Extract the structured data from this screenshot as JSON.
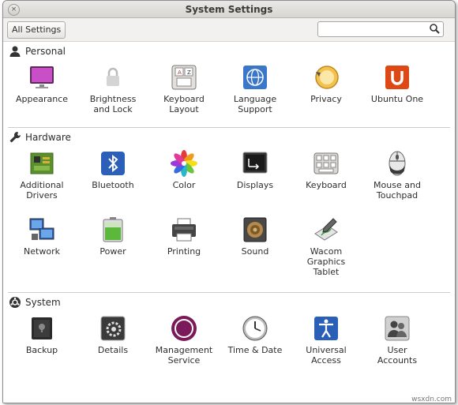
{
  "window": {
    "title": "System Settings",
    "close_glyph": "×"
  },
  "toolbar": {
    "all_settings_label": "All Settings",
    "search_value": "",
    "search_placeholder": ""
  },
  "sections": [
    {
      "title": "Personal",
      "items": [
        "Appearance",
        "Brightness\nand Lock",
        "Keyboard\nLayout",
        "Language\nSupport",
        "Privacy",
        "Ubuntu One"
      ]
    },
    {
      "title": "Hardware",
      "items": [
        "Additional\nDrivers",
        "Bluetooth",
        "Color",
        "Displays",
        "Keyboard",
        "Mouse and\nTouchpad",
        "Network",
        "Power",
        "Printing",
        "Sound",
        "Wacom\nGraphics\nTablet"
      ]
    },
    {
      "title": "System",
      "items": [
        "Backup",
        "Details",
        "Management\nService",
        "Time & Date",
        "Universal\nAccess",
        "User\nAccounts"
      ]
    }
  ],
  "watermark": "wsxdn.com",
  "colors": {
    "accent": "#dd4814",
    "bg": "#f2f1f0"
  }
}
